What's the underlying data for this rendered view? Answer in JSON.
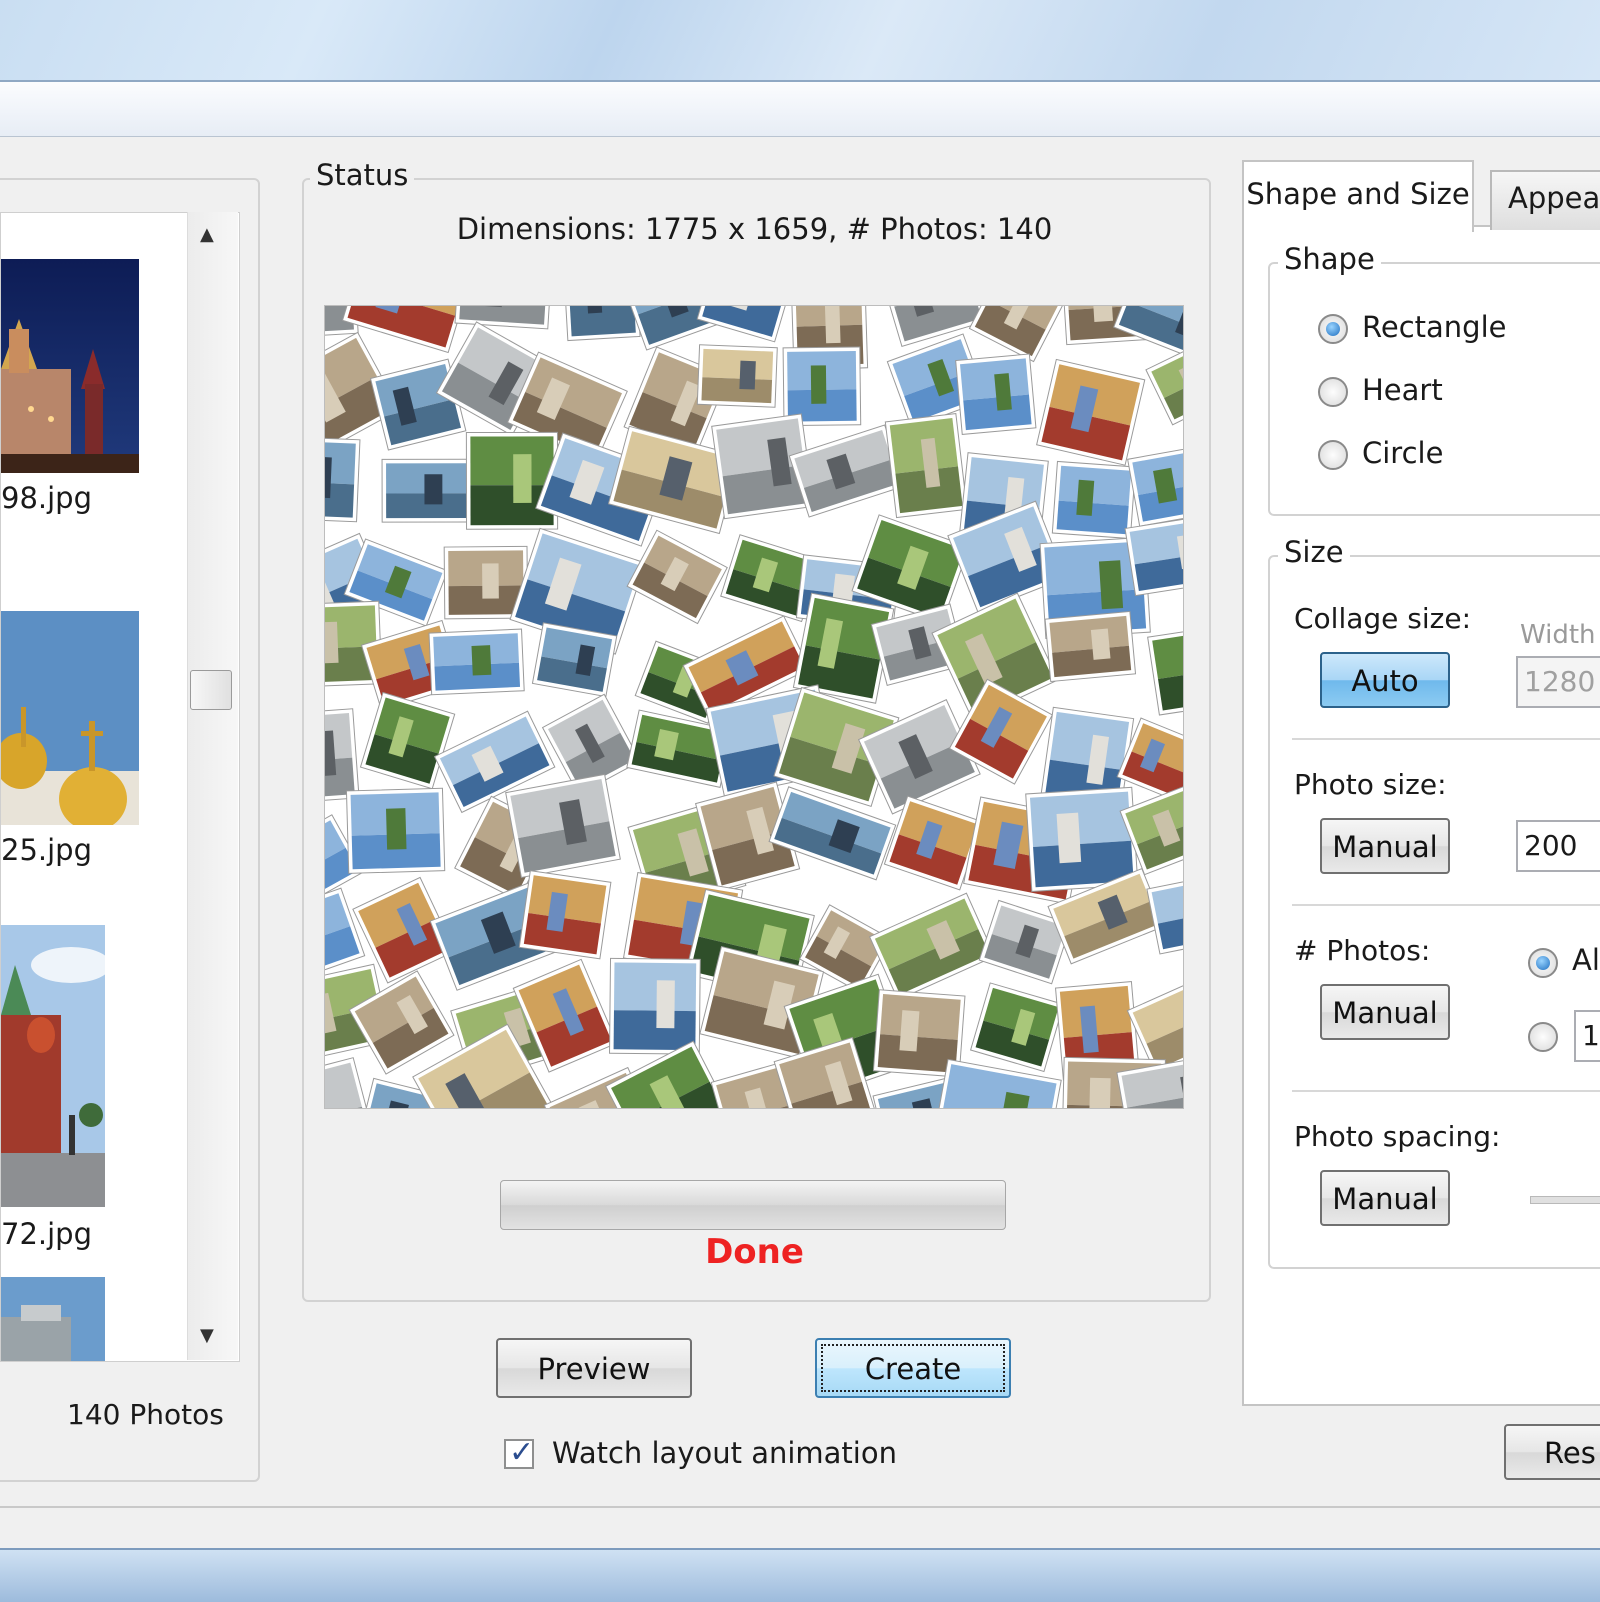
{
  "left_panel": {
    "thumbnails": [
      {
        "caption": "98.jpg"
      },
      {
        "caption": "25.jpg"
      },
      {
        "caption": "72.jpg"
      },
      {
        "caption": ""
      }
    ],
    "photo_count": "140 Photos"
  },
  "status": {
    "legend": "Status",
    "dimensions": "Dimensions: 1775 x 1659, # Photos: 140",
    "progress": 1.0,
    "state": "Done",
    "state_color": "#ee2222"
  },
  "actions": {
    "preview_label": "Preview",
    "create_label": "Create",
    "watch_label": "Watch layout animation",
    "watch_checked": true
  },
  "tabs": {
    "shape_and_size": "Shape and Size",
    "appearance": "Appear"
  },
  "shape": {
    "legend": "Shape",
    "options": [
      "Rectangle",
      "Heart",
      "Circle"
    ],
    "selected": "Rectangle"
  },
  "size": {
    "legend": "Size",
    "collage_size_label": "Collage size:",
    "collage_size_button": "Auto",
    "width_label": "Width",
    "width_value": "1280",
    "photo_size_label": "Photo size:",
    "photo_size_button": "Manual",
    "photo_size_value": "200",
    "photos_label": "# Photos:",
    "photos_button": "Manual",
    "photos_all_label": "Al",
    "photos_count_value": "1",
    "spacing_label": "Photo spacing:",
    "spacing_button": "Manual"
  },
  "restore_label": "Res",
  "colors": {
    "accent": "#3c7fb1",
    "done": "#ee2222"
  }
}
